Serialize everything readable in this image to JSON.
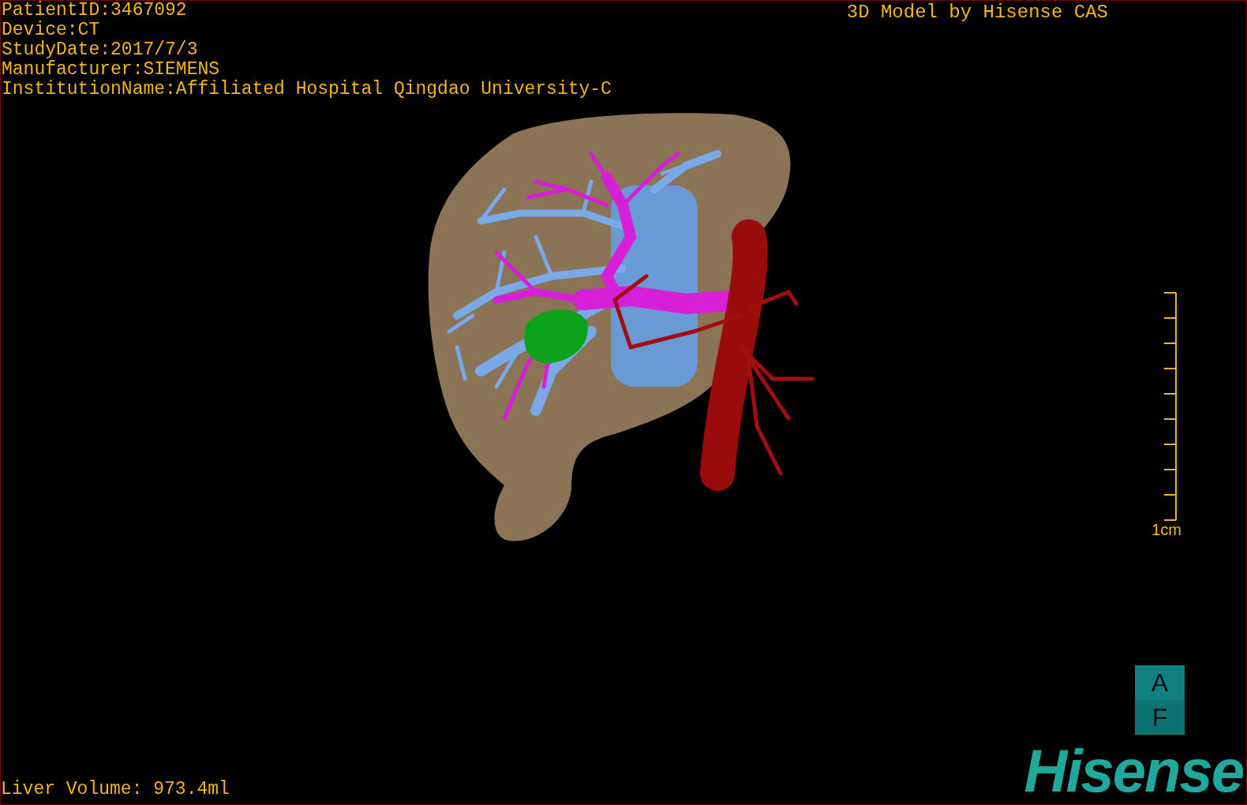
{
  "patient_info": [
    "PatientID:3467092",
    "Device:CT",
    "StudyDate:2017/7/3",
    "Manufacturer:SIEMENS",
    "InstitutionName:Affiliated Hospital Qingdao University-C"
  ],
  "title": "3D Model by Hisense CAS",
  "scale_bar": {
    "label": "1cm"
  },
  "orientation_cube": {
    "top": "A",
    "bottom": "F"
  },
  "liver_volume": "Liver Volume: 973.4ml",
  "logo": "Hisense"
}
